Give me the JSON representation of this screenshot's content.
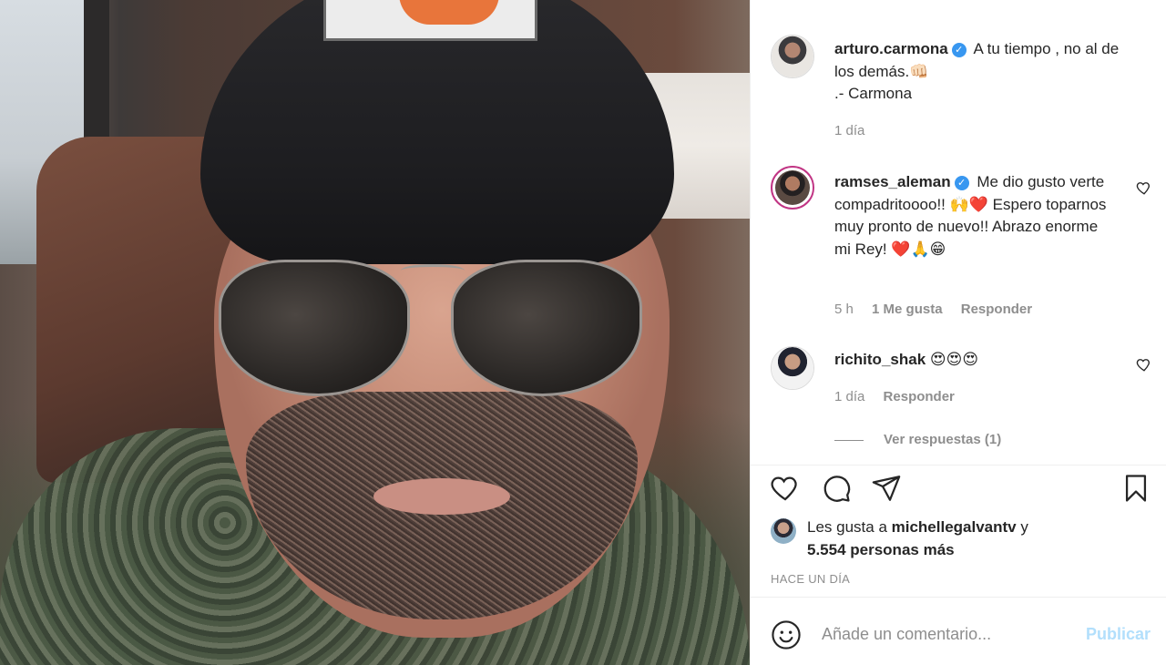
{
  "post": {
    "author": "arturo.carmona",
    "caption_lines": [
      "A tu tiempo , no al de los demás.👊🏻",
      ".- Carmona"
    ],
    "caption_time": "1 día"
  },
  "comments": [
    {
      "user": "ramses_aleman",
      "verified": true,
      "text": "Me dio gusto verte compadritoooo!! 🙌❤️ Espero toparnos muy pronto de nuevo!! Abrazo enorme mi Rey! ❤️🙏😁",
      "time": "5 h",
      "likes": "1 Me gusta",
      "reply_label": "Responder"
    },
    {
      "user": "richito_shak",
      "verified": false,
      "text": "😍😍😍",
      "time": "1 día",
      "reply_label": "Responder",
      "view_replies": "Ver respuestas (1)"
    }
  ],
  "likes": {
    "prefix": "Les gusta a ",
    "user": "michellegalvantv",
    "conj": " y",
    "others": "5.554 personas más"
  },
  "time_ago": "HACE UN DÍA",
  "add_comment": {
    "placeholder": "Añade un comentario...",
    "publish_label": "Publicar"
  },
  "icons": {
    "verified": "verified-badge",
    "like": "heart-icon",
    "comment": "comment-bubble-icon",
    "share": "paper-plane-icon",
    "save": "bookmark-icon",
    "emoji": "smiley-icon"
  },
  "colors": {
    "verified": "#3897f0",
    "publish_disabled": "#b2dffc",
    "secondary_text": "#8e8e8e"
  }
}
